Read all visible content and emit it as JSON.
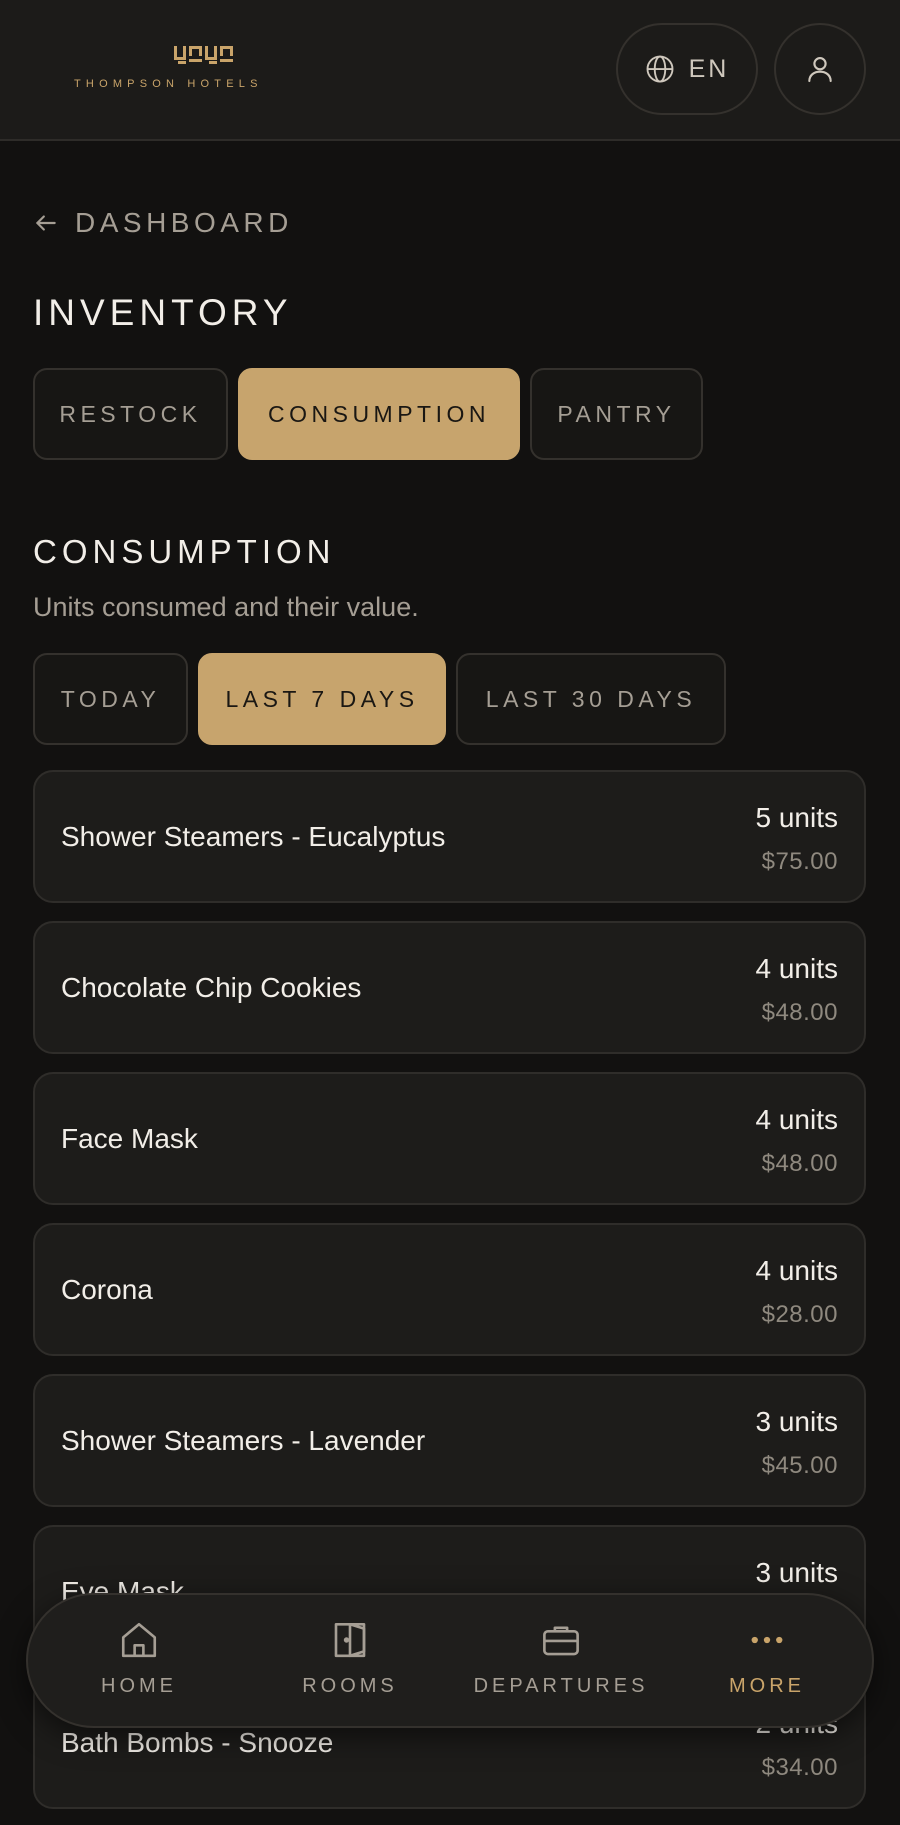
{
  "header": {
    "brand": "THOMPSON HOTELS",
    "brand_mark": "ᗺᗾᗺᗾ",
    "language": "EN",
    "language_icon": "globe-icon",
    "profile_icon": "user-icon"
  },
  "navigation": {
    "back_label": "DASHBOARD",
    "back_icon": "arrow-left-icon"
  },
  "page": {
    "title": "INVENTORY",
    "tabs": [
      {
        "label": "RESTOCK",
        "active": false
      },
      {
        "label": "CONSUMPTION",
        "active": true
      },
      {
        "label": "PANTRY",
        "active": false
      }
    ]
  },
  "section": {
    "title": "CONSUMPTION",
    "subtitle": "Units consumed and their value.",
    "ranges": [
      {
        "label": "TODAY",
        "active": false
      },
      {
        "label": "LAST 7 DAYS",
        "active": true
      },
      {
        "label": "LAST 30 DAYS",
        "active": false
      }
    ]
  },
  "items": [
    {
      "name": "Shower Steamers - Eucalyptus",
      "units": "5 units",
      "value": "$75.00"
    },
    {
      "name": "Chocolate Chip Cookies",
      "units": "4 units",
      "value": "$48.00"
    },
    {
      "name": "Face Mask",
      "units": "4 units",
      "value": "$48.00"
    },
    {
      "name": "Corona",
      "units": "4 units",
      "value": "$28.00"
    },
    {
      "name": "Shower Steamers - Lavender",
      "units": "3 units",
      "value": "$45.00"
    },
    {
      "name": "Eye Mask",
      "units": "3 units",
      "value": ""
    },
    {
      "name": "Bath Bombs - Snooze",
      "units": "2 units",
      "value": "$34.00"
    }
  ],
  "bottom_nav": [
    {
      "label": "HOME",
      "icon": "home-icon",
      "active": false
    },
    {
      "label": "ROOMS",
      "icon": "door-icon",
      "active": false
    },
    {
      "label": "DEPARTURES",
      "icon": "briefcase-icon",
      "active": false
    },
    {
      "label": "MORE",
      "icon": "more-dots-icon",
      "active": true
    }
  ],
  "colors": {
    "background": "#121110",
    "surface": "#1d1c1a",
    "accent": "#c7a46d",
    "text": "#f2eee8",
    "muted": "#a59e94"
  }
}
